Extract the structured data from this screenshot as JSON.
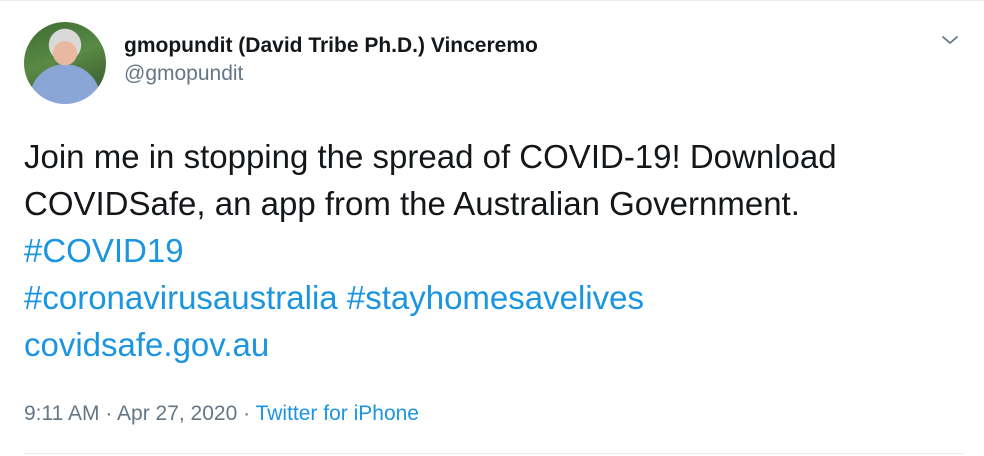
{
  "author": {
    "display_name": "gmopundit (David Tribe Ph.D.) Vinceremo",
    "handle": "@gmopundit",
    "avatar_icon": "profile-photo"
  },
  "tweet": {
    "text_line1": "Join me in stopping the spread of COVID-19! Download",
    "text_line2": "COVIDSafe, an app from the Australian Government.",
    "hashtag1": "#COVID19",
    "hashtag2": "#coronavirusaustralia",
    "hashtag3": "#stayhomesavelives",
    "link": "covidsafe.gov.au"
  },
  "meta": {
    "time": "9:11 AM",
    "separator1": " · ",
    "date": "Apr 27, 2020",
    "separator2": " · ",
    "source": "Twitter for iPhone"
  },
  "colors": {
    "link": "#1b95e0",
    "secondary_text": "#657786",
    "primary_text": "#14171a"
  },
  "menu_icon": "chevron-down-icon"
}
